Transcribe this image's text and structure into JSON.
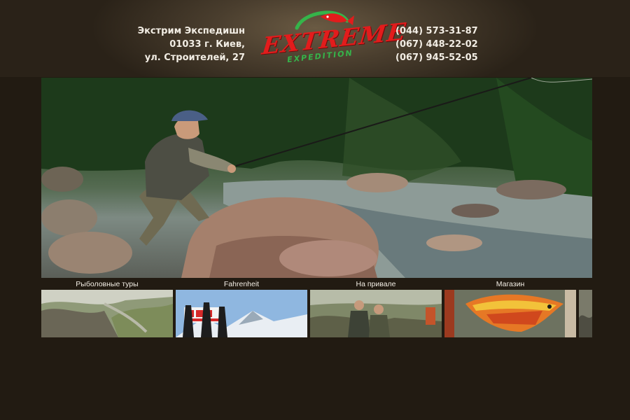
{
  "header": {
    "address_lines": [
      "Экстрим Экспедишн",
      "01033 г. Киев,",
      "ул. Строителей, 27"
    ],
    "phones": [
      "(044) 573-31-87",
      "(067) 448-22-02",
      "(067) 945-52-05"
    ],
    "logo": {
      "word": "EXTREME",
      "sub": "EXPEDITION"
    }
  },
  "hero": {
    "image": "fly-fisherman-casting-on-river-rock"
  },
  "nav": [
    {
      "label": "Рыболовные туры",
      "thumb": "rocky-canyon-landscape"
    },
    {
      "label": "Fahrenheit",
      "thumb": "climbers-with-fahrenheit-banner-on-snowy-peak"
    },
    {
      "label": "На привале",
      "thumb": "fishermen-resting-at-camp"
    },
    {
      "label": "Магазин",
      "thumb": "angler-holding-peacock-bass"
    }
  ],
  "colors": {
    "background": "#221b12",
    "logo_red": "#e21c1c",
    "logo_green": "#35b44a",
    "text": "#f2ede4"
  }
}
